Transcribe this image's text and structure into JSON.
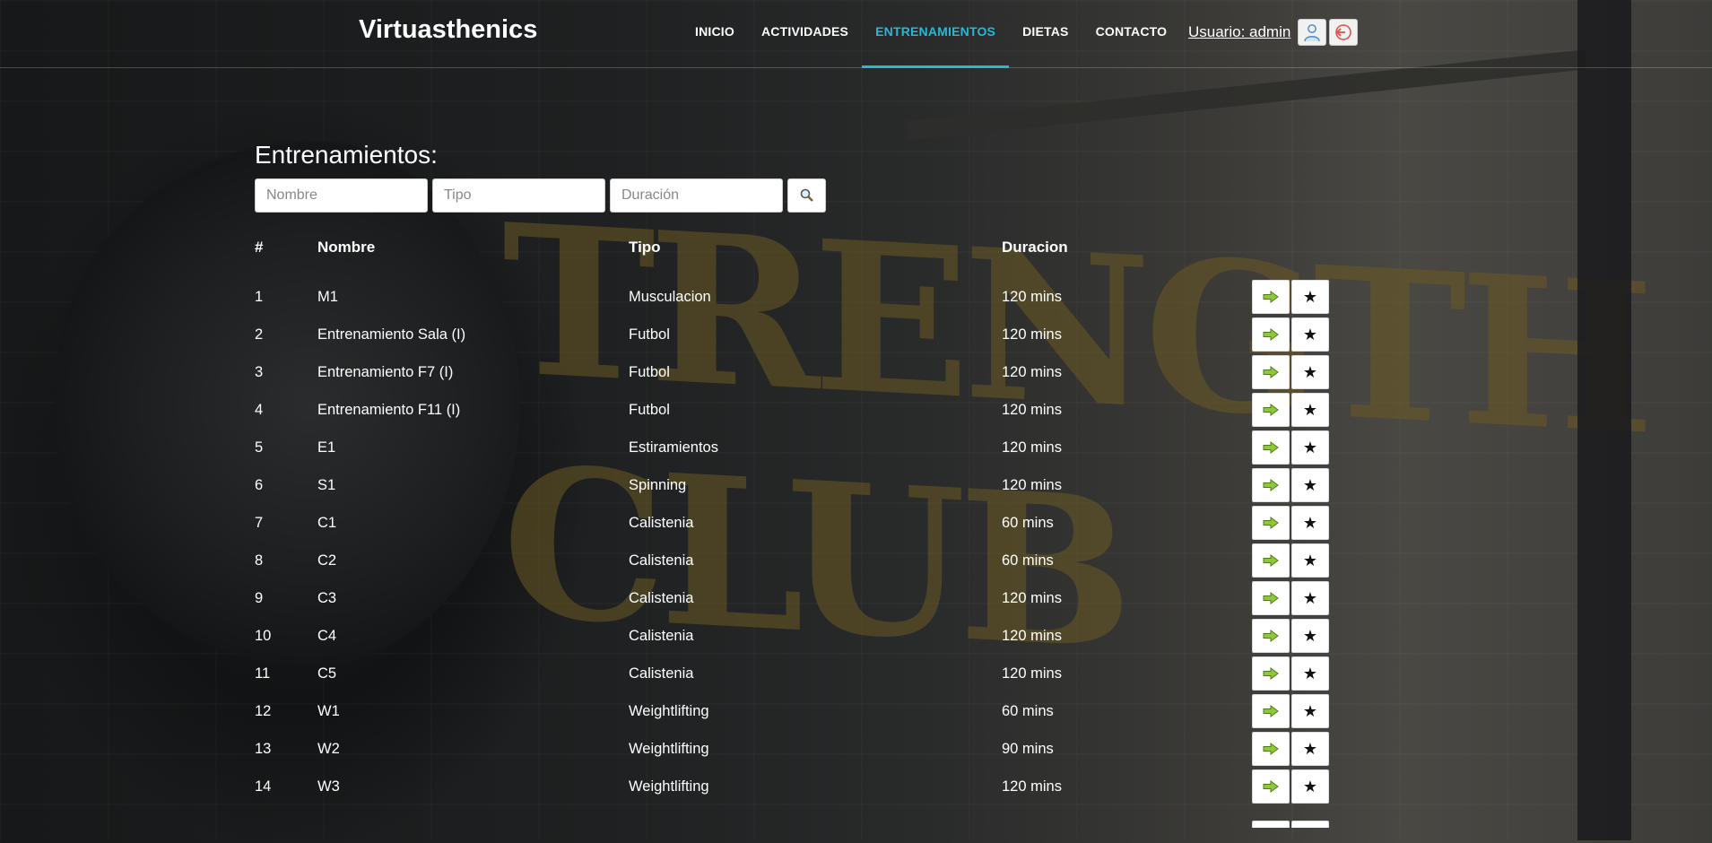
{
  "brand": "Virtuasthenics",
  "nav": {
    "items": [
      {
        "label": "INICIO",
        "active": false
      },
      {
        "label": "ACTIVIDADES",
        "active": false
      },
      {
        "label": "ENTRENAMIENTOS",
        "active": true
      },
      {
        "label": "DIETAS",
        "active": false
      },
      {
        "label": "CONTACTO",
        "active": false
      }
    ],
    "active_color": "#27b8d6"
  },
  "user": {
    "label": "Usuario: admin",
    "profile_icon": "user-profile-icon",
    "logout_icon": "logout-icon"
  },
  "page": {
    "title": "Entrenamientos:"
  },
  "filters": {
    "nombre_placeholder": "Nombre",
    "tipo_placeholder": "Tipo",
    "duracion_placeholder": "Duración",
    "search_icon": "magnifier-icon"
  },
  "table": {
    "headers": {
      "num": "#",
      "nombre": "Nombre",
      "tipo": "Tipo",
      "duracion": "Duracion"
    },
    "rows": [
      {
        "num": "1",
        "nombre": "M1",
        "tipo": "Musculacion",
        "duracion": "120 mins"
      },
      {
        "num": "2",
        "nombre": "Entrenamiento Sala (I)",
        "tipo": "Futbol",
        "duracion": "120 mins"
      },
      {
        "num": "3",
        "nombre": "Entrenamiento F7 (I)",
        "tipo": "Futbol",
        "duracion": "120 mins"
      },
      {
        "num": "4",
        "nombre": "Entrenamiento F11 (I)",
        "tipo": "Futbol",
        "duracion": "120 mins"
      },
      {
        "num": "5",
        "nombre": "E1",
        "tipo": "Estiramientos",
        "duracion": "120 mins"
      },
      {
        "num": "6",
        "nombre": "S1",
        "tipo": "Spinning",
        "duracion": "120 mins"
      },
      {
        "num": "7",
        "nombre": "C1",
        "tipo": "Calistenia",
        "duracion": "60 mins"
      },
      {
        "num": "8",
        "nombre": "C2",
        "tipo": "Calistenia",
        "duracion": "60 mins"
      },
      {
        "num": "9",
        "nombre": "C3",
        "tipo": "Calistenia",
        "duracion": "120 mins"
      },
      {
        "num": "10",
        "nombre": "C4",
        "tipo": "Calistenia",
        "duracion": "120 mins"
      },
      {
        "num": "11",
        "nombre": "C5",
        "tipo": "Calistenia",
        "duracion": "120 mins"
      },
      {
        "num": "12",
        "nombre": "W1",
        "tipo": "Weightlifting",
        "duracion": "60 mins"
      },
      {
        "num": "13",
        "nombre": "W2",
        "tipo": "Weightlifting",
        "duracion": "90 mins"
      },
      {
        "num": "14",
        "nombre": "W3",
        "tipo": "Weightlifting",
        "duracion": "120 mins"
      },
      {
        "num": "",
        "nombre": "",
        "tipo": "",
        "duracion": ""
      }
    ],
    "row_actions": {
      "open_icon": "green-arrow-right-icon",
      "favorite_icon": "star-icon",
      "star_glyph": "★"
    }
  },
  "background_text": "TRENGTH CLUB"
}
